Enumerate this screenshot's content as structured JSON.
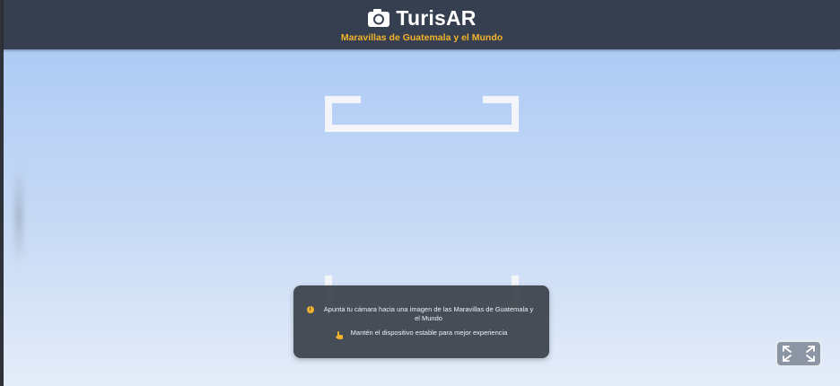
{
  "header": {
    "title": "TurisAR",
    "subtitle": "Maravillas de Guatemala y el Mundo",
    "icon": "camera-icon"
  },
  "scanner": {
    "frame": "scan-frame"
  },
  "info": {
    "line1": "Apunta tu cámara hacia una imagen de las Maravillas de Guatemala y el Mundo",
    "line1_icon": "info-icon",
    "line2": "Mantén el dispositivo estable para mejor experiencia",
    "line2_icon": "hand-pointer-icon"
  },
  "controls": {
    "fullscreen_icon": "expand-icon"
  },
  "colors": {
    "header_bg": "#363f50",
    "accent": "#f2b32a",
    "viewport_top": "#aecbf5",
    "viewport_bottom": "#e4ecf9"
  }
}
